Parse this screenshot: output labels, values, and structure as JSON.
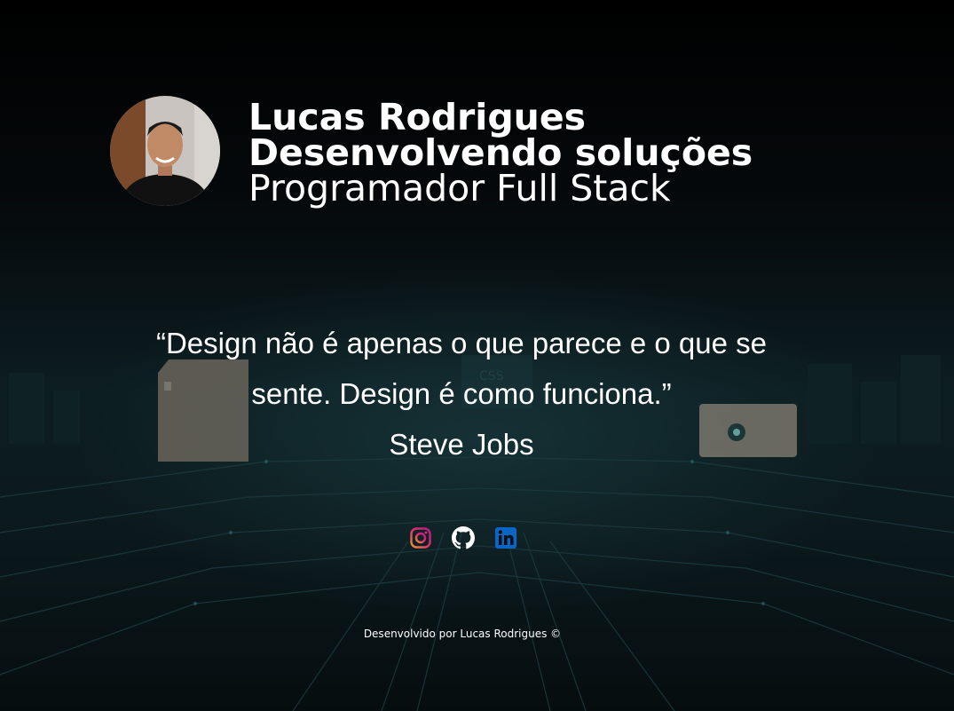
{
  "profile": {
    "name": "Lucas Rodrigues",
    "tagline": "Desenvolvendo soluções",
    "role": "Programador Full Stack"
  },
  "quote": {
    "line1": "“Design não é apenas o que parece e o que se sente. Design é como funciona.”",
    "author": "Steve Jobs"
  },
  "social": [
    {
      "name": "instagram",
      "icon": "instagram-icon",
      "color": "#e1306c"
    },
    {
      "name": "github",
      "icon": "github-icon",
      "color": "#ffffff"
    },
    {
      "name": "linkedin",
      "icon": "linkedin-icon",
      "color": "#0a66c2"
    }
  ],
  "footer": {
    "text": "Desenvolvido por Lucas Rodrigues ©"
  },
  "colors": {
    "background": "#020304",
    "text": "#ffffff",
    "instagram": "#e1306c",
    "linkedin": "#0a66c2"
  }
}
